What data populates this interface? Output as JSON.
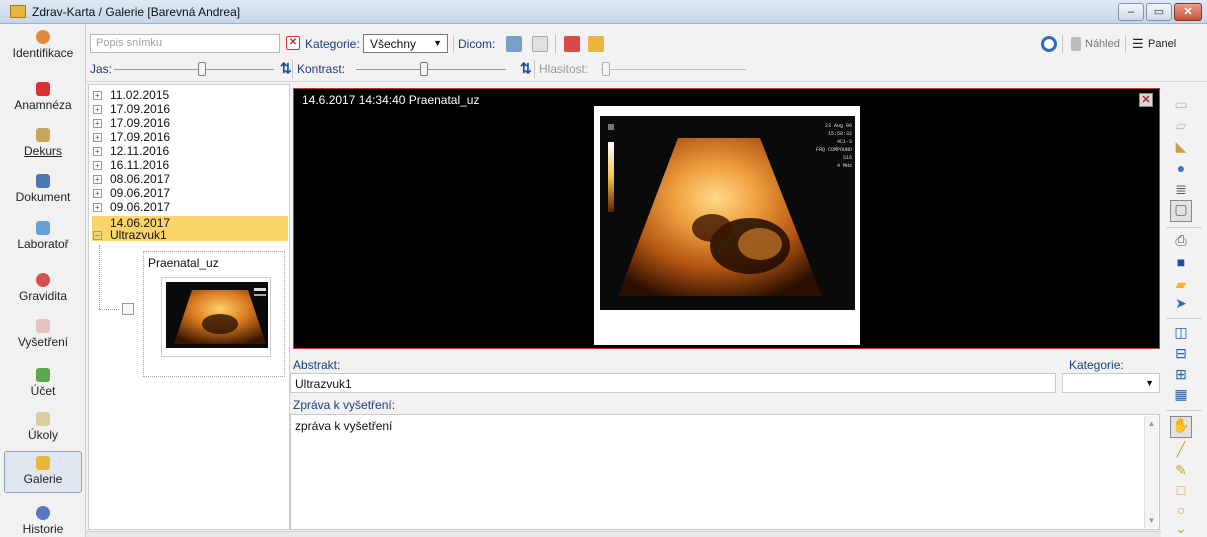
{
  "window": {
    "title": "Zdrav-Karta / Galerie [Barevná Andrea]",
    "min_label": "–",
    "restore_label": "▭",
    "close_label": "✕"
  },
  "nav": {
    "items": [
      {
        "label": "Identifikace",
        "icon": "person-icon",
        "color": "#e08a3c"
      },
      {
        "label": "Anamnéza",
        "icon": "first-aid-icon",
        "color": "#d93030"
      },
      {
        "label": "Dekurs",
        "icon": "briefcase-icon",
        "color": "#c9a45a"
      },
      {
        "label": "Dokument",
        "icon": "document-icon",
        "color": "#4a78b5"
      },
      {
        "label": "Laboratoř",
        "icon": "flask-icon",
        "color": "#6aa0d8"
      },
      {
        "label": "Gravidita",
        "icon": "pregnancy-icon",
        "color": "#d45050"
      },
      {
        "label": "Vyšetření",
        "icon": "grid-icon",
        "color": "#d9a0a0"
      },
      {
        "label": "Účet",
        "icon": "banknote-icon",
        "color": "#5aa84a"
      },
      {
        "label": "Úkoly",
        "icon": "clipboard-icon",
        "color": "#c8b98a"
      },
      {
        "label": "Galerie",
        "icon": "gallery-icon",
        "color": "#e8b63a"
      },
      {
        "label": "Historie",
        "icon": "history-icon",
        "color": "#5a78c0"
      }
    ]
  },
  "toolbar": {
    "search_placeholder": "Popis snímku",
    "clear_label": "✕",
    "kategorie_label": "Kategorie:",
    "kategorie_value": "Všechny",
    "dicom_label": "Dicom:",
    "jas_label": "Jas:",
    "kontrast_label": "Kontrast:",
    "hlasitost_label": "Hlasitost:",
    "nahled_label": "Náhled",
    "panel_label": "Panel",
    "jas_level": 0.55,
    "kontrast_level": 0.45
  },
  "tree": {
    "dates": [
      "11.02.2015",
      "17.09.2016",
      "17.09.2016",
      "17.09.2016",
      "12.11.2016",
      "16.11.2016",
      "08.06.2017",
      "09.06.2017",
      "09.06.2017"
    ],
    "selected_date": "14.06.2017",
    "selected_child": "Ultrazvuk1",
    "thumbnail_name": "Praenatal_uz"
  },
  "viewer": {
    "caption": "14.6.2017 14:34:40 Praenatal_uz",
    "scan_text": [
      "23 Aug 06",
      "15:50:32",
      "4C1-S",
      "FRQ COMPOUND",
      "S16",
      "4 MHz"
    ]
  },
  "form": {
    "abstrakt_label": "Abstrakt:",
    "abstrakt_value": "Ultrazvuk1",
    "kategorie_label": "Kategorie:",
    "kategorie_value": "",
    "zprava_label": "Zpráva k vyšetření:",
    "zprava_value": "zpráva k vyšetření"
  },
  "colors": {
    "selection": "#fbd46c",
    "viewer_border": "#c0392b",
    "accent": "#1f3d7a"
  }
}
